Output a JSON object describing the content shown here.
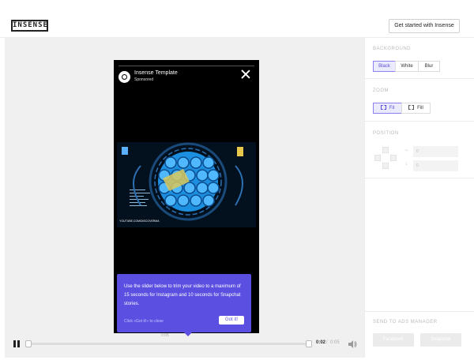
{
  "header": {
    "logo": "INSENSE",
    "cta_label": "Get started with Insense"
  },
  "preview": {
    "ad_title": "Insense Template",
    "ad_subtitle": "Sponsored",
    "video_watermark": "YOUTUBE.COM/DISCOVERMA"
  },
  "tooltip": {
    "text": "Use the slider below to trim your video to a maximum of 15 seconds for Instagram and 10 seconds for Snapchat stories.",
    "hint": "Click «Got it!» to close",
    "button_label": "Got it!"
  },
  "playback": {
    "time_above": "0:05",
    "current_time": "0:02",
    "separator": "/",
    "total_time": "0:05"
  },
  "panel": {
    "background_label": "BACKGROUND",
    "background_options": [
      "Black",
      "White",
      "Blur"
    ],
    "background_selected": "Black",
    "zoom_label": "ZOOM",
    "zoom_options": [
      "Fit",
      "Fill"
    ],
    "zoom_selected": "Fit",
    "position_label": "POSITION",
    "position_x": "0",
    "position_y": "0",
    "send_label": "SEND TO ADS MANAGER",
    "send_buttons": [
      "Facebook",
      "Snapchat"
    ]
  },
  "colors": {
    "accent": "#5a4fe0",
    "active_bg": "#eceafd"
  },
  "icons": [
    "pause-icon",
    "volume-icon",
    "close-icon",
    "fit-icon",
    "fill-icon"
  ]
}
